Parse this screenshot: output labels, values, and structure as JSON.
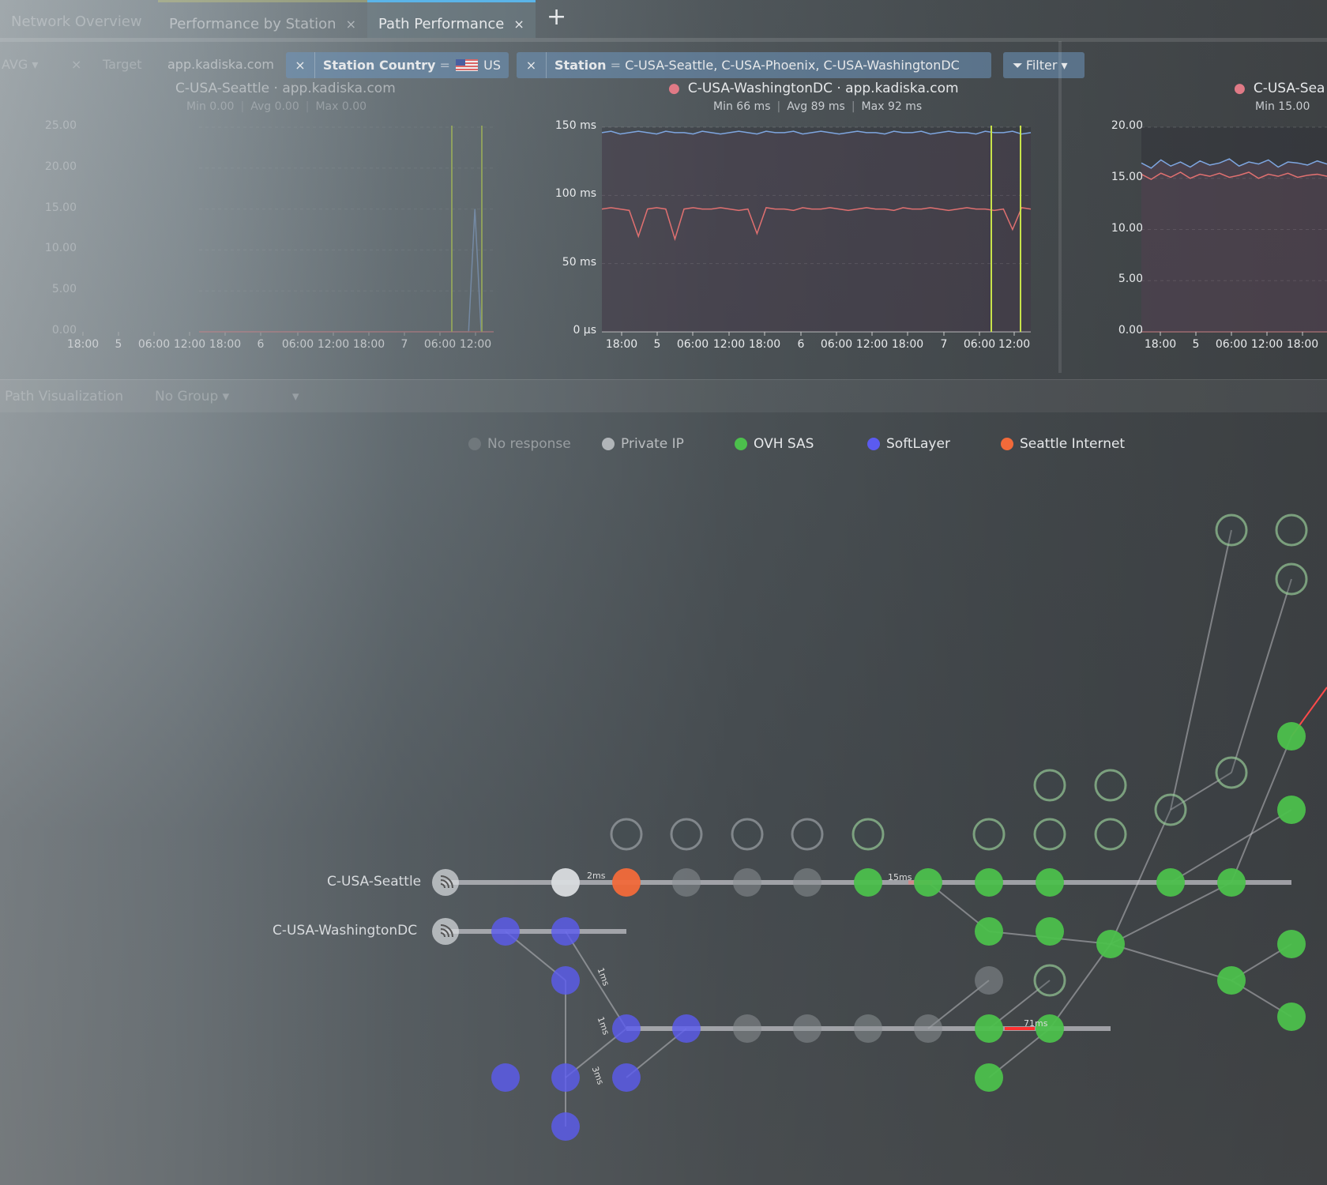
{
  "tabs": [
    {
      "label": "Network Overview",
      "active": false
    },
    {
      "label": "Performance by Station",
      "active": false
    },
    {
      "label": "Path Performance",
      "active": true
    }
  ],
  "tab_close": "×",
  "new_tab": "+",
  "filters": {
    "aggregate": "AVG ▾",
    "target_label": "Target",
    "target_value": "app.kadiska.com",
    "country": {
      "key": "Station Country",
      "op": "=",
      "value": "US",
      "flag": "us-flag-icon"
    },
    "station": {
      "key": "Station",
      "op": "=",
      "values": "C-USA-Seattle,  C-USA-Phoenix,  C-USA-WashingtonDC"
    },
    "remove": "×",
    "filter_button": "Filter ▾"
  },
  "charts": [
    {
      "title": "C-USA-Seattle · app.kadiska.com",
      "min_label": "Min",
      "min": "0.00",
      "avg_label": "Avg",
      "avg": "0.00",
      "max_label": "Max",
      "max": "0.00"
    },
    {
      "title": "C-USA-WashingtonDC · app.kadiska.com",
      "min_label": "Min",
      "min": "66 ms",
      "avg_label": "Avg",
      "avg": "89 ms",
      "max_label": "Max",
      "max": "92 ms"
    },
    {
      "title": "C-USA-Sea",
      "min_label": "Min",
      "min": "15.00",
      "avg_label": "",
      "avg": "",
      "max_label": "",
      "max": ""
    }
  ],
  "chart_data": [
    {
      "type": "line",
      "yticks": [
        "25.00",
        "20.00",
        "15.00",
        "10.00",
        "5.00",
        "0.00"
      ],
      "ylim": [
        0,
        25
      ],
      "xticks": [
        "18:00",
        "5",
        "06:00",
        "12:00",
        "18:00",
        "6",
        "06:00",
        "12:00",
        "18:00",
        "7",
        "06:00",
        "12:00"
      ],
      "series": [
        {
          "color": "#8fb3e6",
          "values": [
            0,
            0,
            0,
            0,
            0,
            0,
            0,
            0,
            0,
            0,
            0,
            0,
            0,
            0,
            0,
            0,
            0,
            0,
            0,
            0,
            0,
            0,
            0,
            0,
            0,
            0,
            0,
            0,
            0,
            0,
            0,
            0,
            0,
            0,
            0,
            0,
            0,
            0,
            0,
            0,
            0,
            0,
            0,
            0,
            15,
            0,
            0,
            0
          ]
        },
        {
          "color": "#e07a7a",
          "values": [
            0,
            0,
            0,
            0,
            0,
            0,
            0,
            0,
            0,
            0,
            0,
            0,
            0,
            0,
            0,
            0,
            0,
            0,
            0,
            0,
            0,
            0,
            0,
            0,
            0,
            0,
            0,
            0,
            0,
            0,
            0,
            0,
            0,
            0,
            0,
            0,
            0,
            0,
            0,
            0,
            0,
            0,
            0,
            0,
            0,
            0,
            0,
            0
          ]
        }
      ],
      "markers": [
        "06:00",
        "12:00"
      ]
    },
    {
      "type": "line",
      "yticks": [
        "150 ms",
        "100 ms",
        "50 ms",
        "0 µs"
      ],
      "ylim": [
        0,
        150
      ],
      "xticks": [
        "18:00",
        "5",
        "06:00",
        "12:00",
        "18:00",
        "6",
        "06:00",
        "12:00",
        "18:00",
        "7",
        "06:00",
        "12:00"
      ],
      "series": [
        {
          "color": "#7ea6e0",
          "values": [
            146,
            147,
            145,
            146,
            147,
            146,
            145,
            147,
            146,
            146,
            145,
            147,
            146,
            145,
            146,
            147,
            146,
            145,
            147,
            146,
            146,
            147,
            145,
            146,
            147,
            146,
            145,
            146,
            147,
            146,
            146,
            145,
            147,
            146,
            146,
            147,
            145,
            146,
            147,
            146,
            146,
            145,
            147,
            146,
            146,
            147,
            145,
            146
          ]
        },
        {
          "color": "#e07070",
          "values": [
            90,
            91,
            90,
            89,
            70,
            90,
            91,
            90,
            68,
            90,
            91,
            90,
            90,
            91,
            90,
            89,
            90,
            72,
            91,
            90,
            90,
            89,
            91,
            90,
            90,
            91,
            90,
            89,
            90,
            91,
            90,
            90,
            89,
            91,
            90,
            90,
            91,
            90,
            89,
            90,
            91,
            90,
            90,
            89,
            90,
            75,
            91,
            90
          ]
        }
      ],
      "markers": [
        "06:00",
        "12:00"
      ]
    },
    {
      "type": "area",
      "yticks": [
        "20.00",
        "15.00",
        "10.00",
        "5.00",
        "0.00"
      ],
      "ylim": [
        0,
        20
      ],
      "xticks": [
        "18:00",
        "5",
        "06:00",
        "12:00",
        "18:00"
      ],
      "series": [
        {
          "color": "#7ea6e0",
          "values": [
            16.5,
            16,
            16.8,
            16.2,
            16.6,
            16.1,
            16.7,
            16.3,
            16.5,
            16.9,
            16.2,
            16.6,
            16.4,
            16.8,
            16.1,
            16.6,
            16.5,
            16.3,
            16.7,
            16.4
          ]
        },
        {
          "color": "#e07070",
          "values": [
            15.4,
            14.9,
            15.5,
            15.1,
            15.6,
            15,
            15.4,
            15.2,
            15.5,
            15.1,
            15.3,
            15.6,
            15,
            15.4,
            15.2,
            15.5,
            15.1,
            15.3,
            15.4,
            15.2
          ]
        }
      ]
    }
  ],
  "path_viz": {
    "title": "Path Visualization",
    "group": "No Group ▾",
    "other": "▾"
  },
  "legend": [
    {
      "label": "No response",
      "color": "#8a8f93"
    },
    {
      "label": "Private IP",
      "color": "#d9dcdf"
    },
    {
      "label": "OVH SAS",
      "color": "#4cc04c"
    },
    {
      "label": "SoftLayer",
      "color": "#5b5bf0"
    },
    {
      "label": "Seattle Internet",
      "color": "#f26a3a"
    }
  ],
  "stations": [
    {
      "label": "C-USA-Seattle",
      "icon": "wifi-signal-icon"
    },
    {
      "label": "C-USA-WashingtonDC",
      "icon": "wifi-signal-icon"
    }
  ],
  "edge_labels": [
    "2ms",
    "15ms",
    "1ms",
    "1ms",
    "3ms",
    "71ms"
  ]
}
